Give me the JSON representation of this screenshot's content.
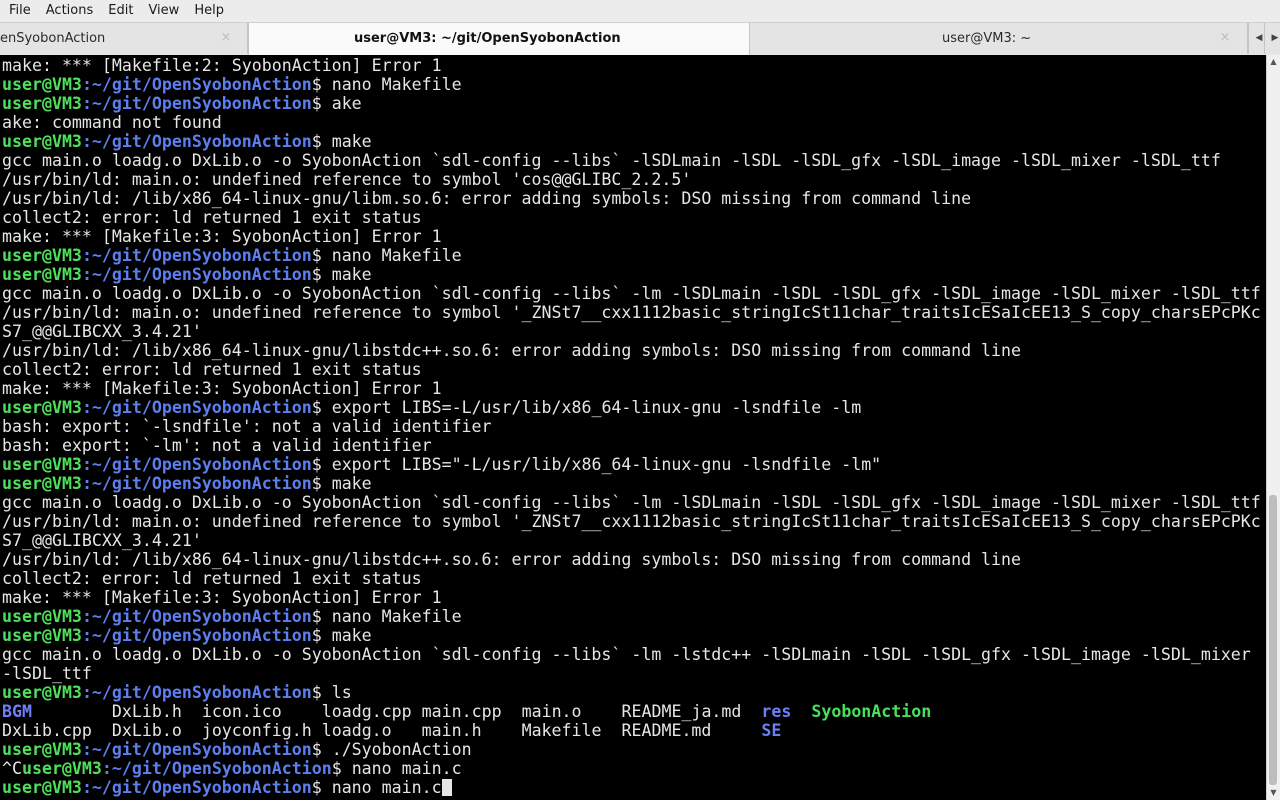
{
  "menu": {
    "file": "File",
    "actions": "Actions",
    "edit": "Edit",
    "view": "View",
    "help": "Help"
  },
  "tabs": [
    {
      "label": "enSyobonAction",
      "close": "×"
    },
    {
      "label": "user@VM3: ~/git/OpenSyobonAction",
      "close": "×"
    },
    {
      "label": "user@VM3: ~",
      "close": "×"
    }
  ],
  "tab_scroll": {
    "left": "◀",
    "right": "▶"
  },
  "prompt": {
    "user": "user@VM3",
    "path": ":~/git/OpenSyobonAction",
    "symbol": "$ "
  },
  "terminal": {
    "lines": [
      {
        "type": "out",
        "text": "make: *** [Makefile:2: SyobonAction] Error 1"
      },
      {
        "type": "cmd",
        "text": "nano Makefile"
      },
      {
        "type": "cmd",
        "text": "ake"
      },
      {
        "type": "out",
        "text": "ake: command not found"
      },
      {
        "type": "cmd",
        "text": "make"
      },
      {
        "type": "out",
        "text": "gcc main.o loadg.o DxLib.o -o SyobonAction `sdl-config --libs` -lSDLmain -lSDL -lSDL_gfx -lSDL_image -lSDL_mixer -lSDL_ttf"
      },
      {
        "type": "out",
        "text": "/usr/bin/ld: main.o: undefined reference to symbol 'cos@@GLIBC_2.2.5'"
      },
      {
        "type": "out",
        "text": "/usr/bin/ld: /lib/x86_64-linux-gnu/libm.so.6: error adding symbols: DSO missing from command line"
      },
      {
        "type": "out",
        "text": "collect2: error: ld returned 1 exit status"
      },
      {
        "type": "out",
        "text": "make: *** [Makefile:3: SyobonAction] Error 1"
      },
      {
        "type": "cmd",
        "text": "nano Makefile"
      },
      {
        "type": "cmd",
        "text": "make"
      },
      {
        "type": "out",
        "text": "gcc main.o loadg.o DxLib.o -o SyobonAction `sdl-config --libs` -lm -lSDLmain -lSDL -lSDL_gfx -lSDL_image -lSDL_mixer -lSDL_ttf"
      },
      {
        "type": "out",
        "text": "/usr/bin/ld: main.o: undefined reference to symbol '_ZNSt7__cxx1112basic_stringIcSt11char_traitsIcESaIcEE13_S_copy_charsEPcPKc"
      },
      {
        "type": "out",
        "text": "S7_@@GLIBCXX_3.4.21'"
      },
      {
        "type": "out",
        "text": "/usr/bin/ld: /lib/x86_64-linux-gnu/libstdc++.so.6: error adding symbols: DSO missing from command line"
      },
      {
        "type": "out",
        "text": "collect2: error: ld returned 1 exit status"
      },
      {
        "type": "out",
        "text": "make: *** [Makefile:3: SyobonAction] Error 1"
      },
      {
        "type": "cmd",
        "text": "export LIBS=-L/usr/lib/x86_64-linux-gnu -lsndfile -lm"
      },
      {
        "type": "out",
        "text": "bash: export: `-lsndfile': not a valid identifier"
      },
      {
        "type": "out",
        "text": "bash: export: `-lm': not a valid identifier"
      },
      {
        "type": "cmd",
        "text": "export LIBS=\"-L/usr/lib/x86_64-linux-gnu -lsndfile -lm\""
      },
      {
        "type": "cmd",
        "text": "make"
      },
      {
        "type": "out",
        "text": "gcc main.o loadg.o DxLib.o -o SyobonAction `sdl-config --libs` -lm -lSDLmain -lSDL -lSDL_gfx -lSDL_image -lSDL_mixer -lSDL_ttf"
      },
      {
        "type": "out",
        "text": "/usr/bin/ld: main.o: undefined reference to symbol '_ZNSt7__cxx1112basic_stringIcSt11char_traitsIcESaIcEE13_S_copy_charsEPcPKc"
      },
      {
        "type": "out",
        "text": "S7_@@GLIBCXX_3.4.21'"
      },
      {
        "type": "out",
        "text": "/usr/bin/ld: /lib/x86_64-linux-gnu/libstdc++.so.6: error adding symbols: DSO missing from command line"
      },
      {
        "type": "out",
        "text": "collect2: error: ld returned 1 exit status"
      },
      {
        "type": "out",
        "text": "make: *** [Makefile:3: SyobonAction] Error 1"
      },
      {
        "type": "cmd",
        "text": "nano Makefile"
      },
      {
        "type": "cmd",
        "text": "make"
      },
      {
        "type": "out",
        "text": "gcc main.o loadg.o DxLib.o -o SyobonAction `sdl-config --libs` -lm -lstdc++ -lSDLmain -lSDL -lSDL_gfx -lSDL_image -lSDL_mixer"
      },
      {
        "type": "out",
        "text": "-lSDL_ttf"
      },
      {
        "type": "cmd",
        "text": "ls"
      },
      {
        "type": "ls",
        "entries": [
          {
            "name": "BGM",
            "kind": "dir",
            "pad": 11
          },
          {
            "name": "DxLib.h",
            "kind": "file",
            "pad": 9
          },
          {
            "name": "icon.ico",
            "kind": "file",
            "pad": 12
          },
          {
            "name": "loadg.cpp",
            "kind": "file",
            "pad": 10
          },
          {
            "name": "main.cpp",
            "kind": "file",
            "pad": 10
          },
          {
            "name": "main.o",
            "kind": "file",
            "pad": 10
          },
          {
            "name": "README_ja.md",
            "kind": "file",
            "pad": 14
          },
          {
            "name": "res",
            "kind": "dir",
            "pad": 5
          },
          {
            "name": "SyobonAction",
            "kind": "exe",
            "pad": 0
          }
        ]
      },
      {
        "type": "ls",
        "entries": [
          {
            "name": "DxLib.cpp",
            "kind": "file",
            "pad": 11
          },
          {
            "name": "DxLib.o",
            "kind": "file",
            "pad": 9
          },
          {
            "name": "joyconfig.h",
            "kind": "file",
            "pad": 12
          },
          {
            "name": "loadg.o",
            "kind": "file",
            "pad": 10
          },
          {
            "name": "main.h",
            "kind": "file",
            "pad": 10
          },
          {
            "name": "Makefile",
            "kind": "file",
            "pad": 10
          },
          {
            "name": "README.md",
            "kind": "file",
            "pad": 14
          },
          {
            "name": "SE",
            "kind": "dir",
            "pad": 0
          }
        ]
      },
      {
        "type": "cmd",
        "text": "./SyobonAction"
      },
      {
        "type": "cmd",
        "prefix": "^C",
        "text": "nano main.c"
      },
      {
        "type": "cmd",
        "text": "nano main.c",
        "cursor": true
      }
    ]
  }
}
